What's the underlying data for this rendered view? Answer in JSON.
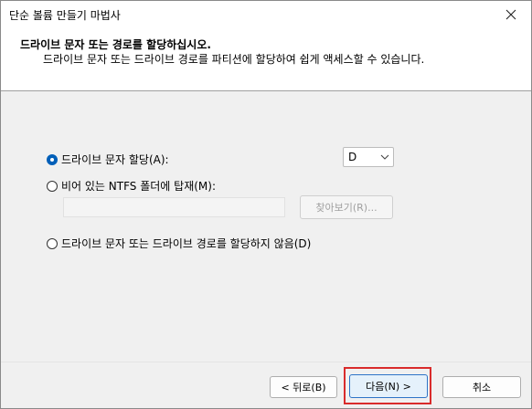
{
  "window": {
    "title": "단순 볼륨 만들기 마법사",
    "close_icon": "close-icon"
  },
  "header": {
    "title": "드라이브 문자 또는 경로를 할당하십시오.",
    "subtitle": "드라이브 문자 또는 드라이브 경로를 파티션에 할당하여 쉽게 액세스할 수 있습니다."
  },
  "options": {
    "assign_letter": {
      "label": "드라이브 문자 할당(A):",
      "checked": true
    },
    "drive_letter": {
      "value": "D"
    },
    "mount_folder": {
      "label": "비어 있는 NTFS 폴더에 탑재(M):",
      "checked": false
    },
    "folder_path": {
      "value": ""
    },
    "browse_label": "찾아보기(R)...",
    "no_letter": {
      "label": "드라이브 문자 또는 드라이브 경로를 할당하지 않음(D)",
      "checked": false
    }
  },
  "footer": {
    "back_label": "< 뒤로(B)",
    "next_label": "다음(N) >",
    "cancel_label": "취소"
  },
  "colors": {
    "accent": "#005fb8",
    "highlight": "#d92b2b"
  }
}
